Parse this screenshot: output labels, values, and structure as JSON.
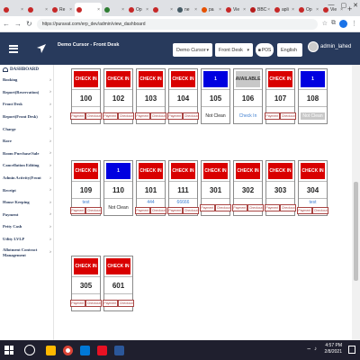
{
  "browser": {
    "tabs": [
      {
        "label": "",
        "active": false
      },
      {
        "label": "",
        "active": false
      },
      {
        "label": "Re",
        "active": false
      },
      {
        "label": "",
        "active": true
      },
      {
        "label": "",
        "active": false
      },
      {
        "label": "Op",
        "active": false
      },
      {
        "label": "",
        "active": false
      },
      {
        "label": "ne",
        "active": false
      },
      {
        "label": "pa",
        "active": false
      },
      {
        "label": "Vie",
        "active": false
      },
      {
        "label": "BBC",
        "active": false
      },
      {
        "label": "apli",
        "active": false
      },
      {
        "label": "Op",
        "active": false
      },
      {
        "label": "Vie",
        "active": false
      }
    ],
    "url": "https://puravat.com/erp_dev/admin/view_dashboard"
  },
  "header": {
    "brand": "Demo Cursor - Front Desk",
    "property_select": "Demo Cursor",
    "department_select": "Front Desk",
    "pos_label": "POS",
    "language_select": "English",
    "user": "admin_lahed"
  },
  "sidebar": {
    "dashboard_label": "DASHBOARD",
    "items": [
      "Booking",
      "Report(Reservation)",
      "Front Desk",
      "Report(Front Desk)",
      "Charge",
      "Rave",
      "Room Purchase/Sale",
      "Cancellation Editing",
      "Admin Activity(Front",
      "Receipt",
      "House Keeping",
      "Payment",
      "Petty Cash",
      "Utlity LVLP",
      "Allotment Contract Management"
    ]
  },
  "rooms": [
    {
      "status": "CHECK IN",
      "kind": "checkin",
      "number": "100",
      "bottom": "buttons"
    },
    {
      "status": "CHECK IN",
      "kind": "checkin",
      "number": "102",
      "bottom": "buttons"
    },
    {
      "status": "CHECK IN",
      "kind": "checkin",
      "number": "103",
      "bottom": "buttons"
    },
    {
      "status": "CHECK IN",
      "kind": "checkin",
      "number": "104",
      "bottom": "buttons"
    },
    {
      "status": "1",
      "kind": "blue",
      "number": "105",
      "bottom": "text",
      "text": "Not Clean",
      "text_style": "plain"
    },
    {
      "status": "AVAILABLE",
      "kind": "available",
      "number": "106",
      "bottom": "text",
      "text": "Check In",
      "text_style": "link"
    },
    {
      "status": "CHECK IN",
      "kind": "checkin",
      "number": "107",
      "bottom": "buttons"
    },
    {
      "status": "1",
      "kind": "blue",
      "number": "108",
      "bottom": "text",
      "text": "Not Clean",
      "text_style": "disabled"
    },
    {
      "status": "CHECK IN",
      "kind": "checkin",
      "number": "109",
      "bottom": "text",
      "text": "test",
      "text_style": "link",
      "buttons_below": true
    },
    {
      "status": "1",
      "kind": "blue",
      "number": "110",
      "bottom": "text",
      "text": "Not Clean",
      "text_style": "plain"
    },
    {
      "status": "CHECK IN",
      "kind": "checkin",
      "number": "101",
      "bottom": "text",
      "text": "444",
      "text_style": "link",
      "buttons_below": true
    },
    {
      "status": "CHECK IN",
      "kind": "checkin",
      "number": "111",
      "bottom": "text",
      "text": "66666",
      "text_style": "link",
      "buttons_below": true
    },
    {
      "status": "CHECK IN",
      "kind": "checkin",
      "number": "301",
      "bottom": "buttons"
    },
    {
      "status": "CHECK IN",
      "kind": "checkin",
      "number": "302",
      "bottom": "buttons"
    },
    {
      "status": "CHECK IN",
      "kind": "checkin",
      "number": "303",
      "bottom": "buttons"
    },
    {
      "status": "CHECK IN",
      "kind": "checkin",
      "number": "304",
      "bottom": "text",
      "text": "test",
      "text_style": "link",
      "buttons_below": true
    },
    {
      "status": "CHECK IN",
      "kind": "checkin",
      "number": "305",
      "bottom": "buttons"
    },
    {
      "status": "CHECK IN",
      "kind": "checkin",
      "number": "601",
      "bottom": "buttons"
    }
  ],
  "room_buttons": {
    "payment": "Payment",
    "checkout": "Checkout"
  },
  "taskbar": {
    "time": "4:57 PM",
    "date": "2/8/2021"
  }
}
